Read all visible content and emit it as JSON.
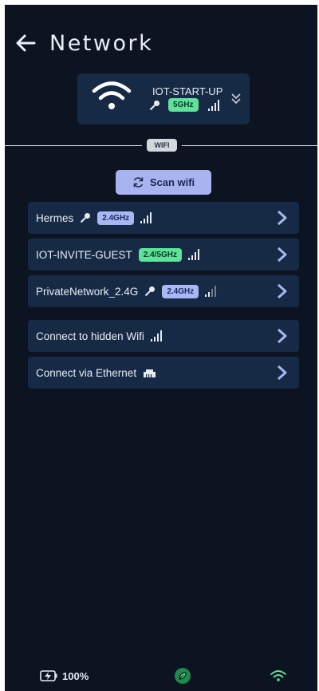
{
  "header": {
    "title": "Network"
  },
  "current": {
    "ssid": "IOT-START-UP",
    "band": "5GHz"
  },
  "divider": {
    "label": "WIFI"
  },
  "scan": {
    "label": "Scan wifi"
  },
  "networks": [
    {
      "name": "Hermes",
      "secured": true,
      "band": "2.4GHz",
      "band_style": "blue"
    },
    {
      "name": "IOT-INVITE-GUEST",
      "secured": false,
      "band": "2.4/5GHz",
      "band_style": "green"
    },
    {
      "name": "PrivateNetwork_2.4G",
      "secured": true,
      "band": "2.4GHz",
      "band_style": "blue"
    }
  ],
  "extra_options": [
    {
      "label": "Connect to hidden Wifi",
      "icon": "signal-icon"
    },
    {
      "label": "Connect via Ethernet",
      "icon": "ethernet-icon"
    }
  ],
  "statusbar": {
    "battery": "100%"
  },
  "colors": {
    "background": "#0b1420",
    "card": "#172a45",
    "accent_blue": "#a7b4f0",
    "accent_green": "#5ee39a"
  }
}
